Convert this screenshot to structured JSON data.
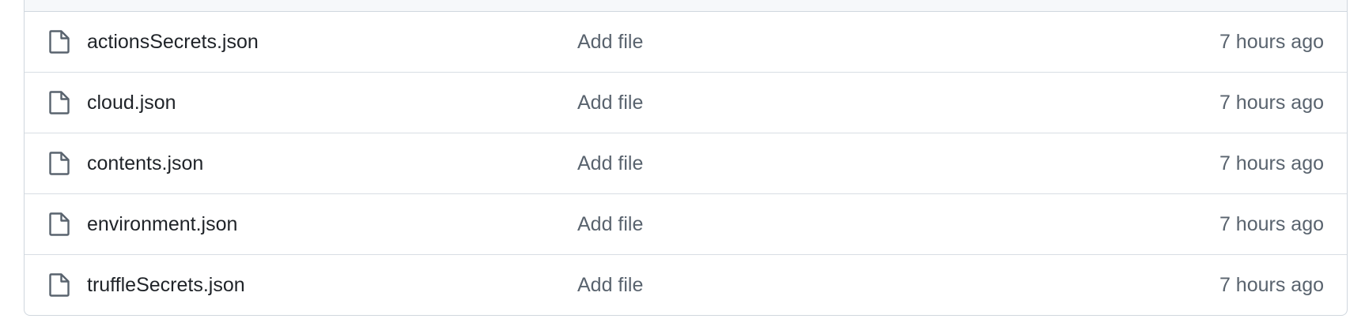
{
  "colors": {
    "file_name": "#1f2328",
    "muted_text": "#59636e",
    "border": "#d0d7de",
    "header_bg": "#f6f8fa"
  },
  "files": [
    {
      "icon": "file-icon",
      "name": "actionsSecrets.json",
      "commit_message": "Add file",
      "time": "7 hours ago"
    },
    {
      "icon": "file-icon",
      "name": "cloud.json",
      "commit_message": "Add file",
      "time": "7 hours ago"
    },
    {
      "icon": "file-icon",
      "name": "contents.json",
      "commit_message": "Add file",
      "time": "7 hours ago"
    },
    {
      "icon": "file-icon",
      "name": "environment.json",
      "commit_message": "Add file",
      "time": "7 hours ago"
    },
    {
      "icon": "file-icon",
      "name": "truffleSecrets.json",
      "commit_message": "Add file",
      "time": "7 hours ago"
    }
  ]
}
